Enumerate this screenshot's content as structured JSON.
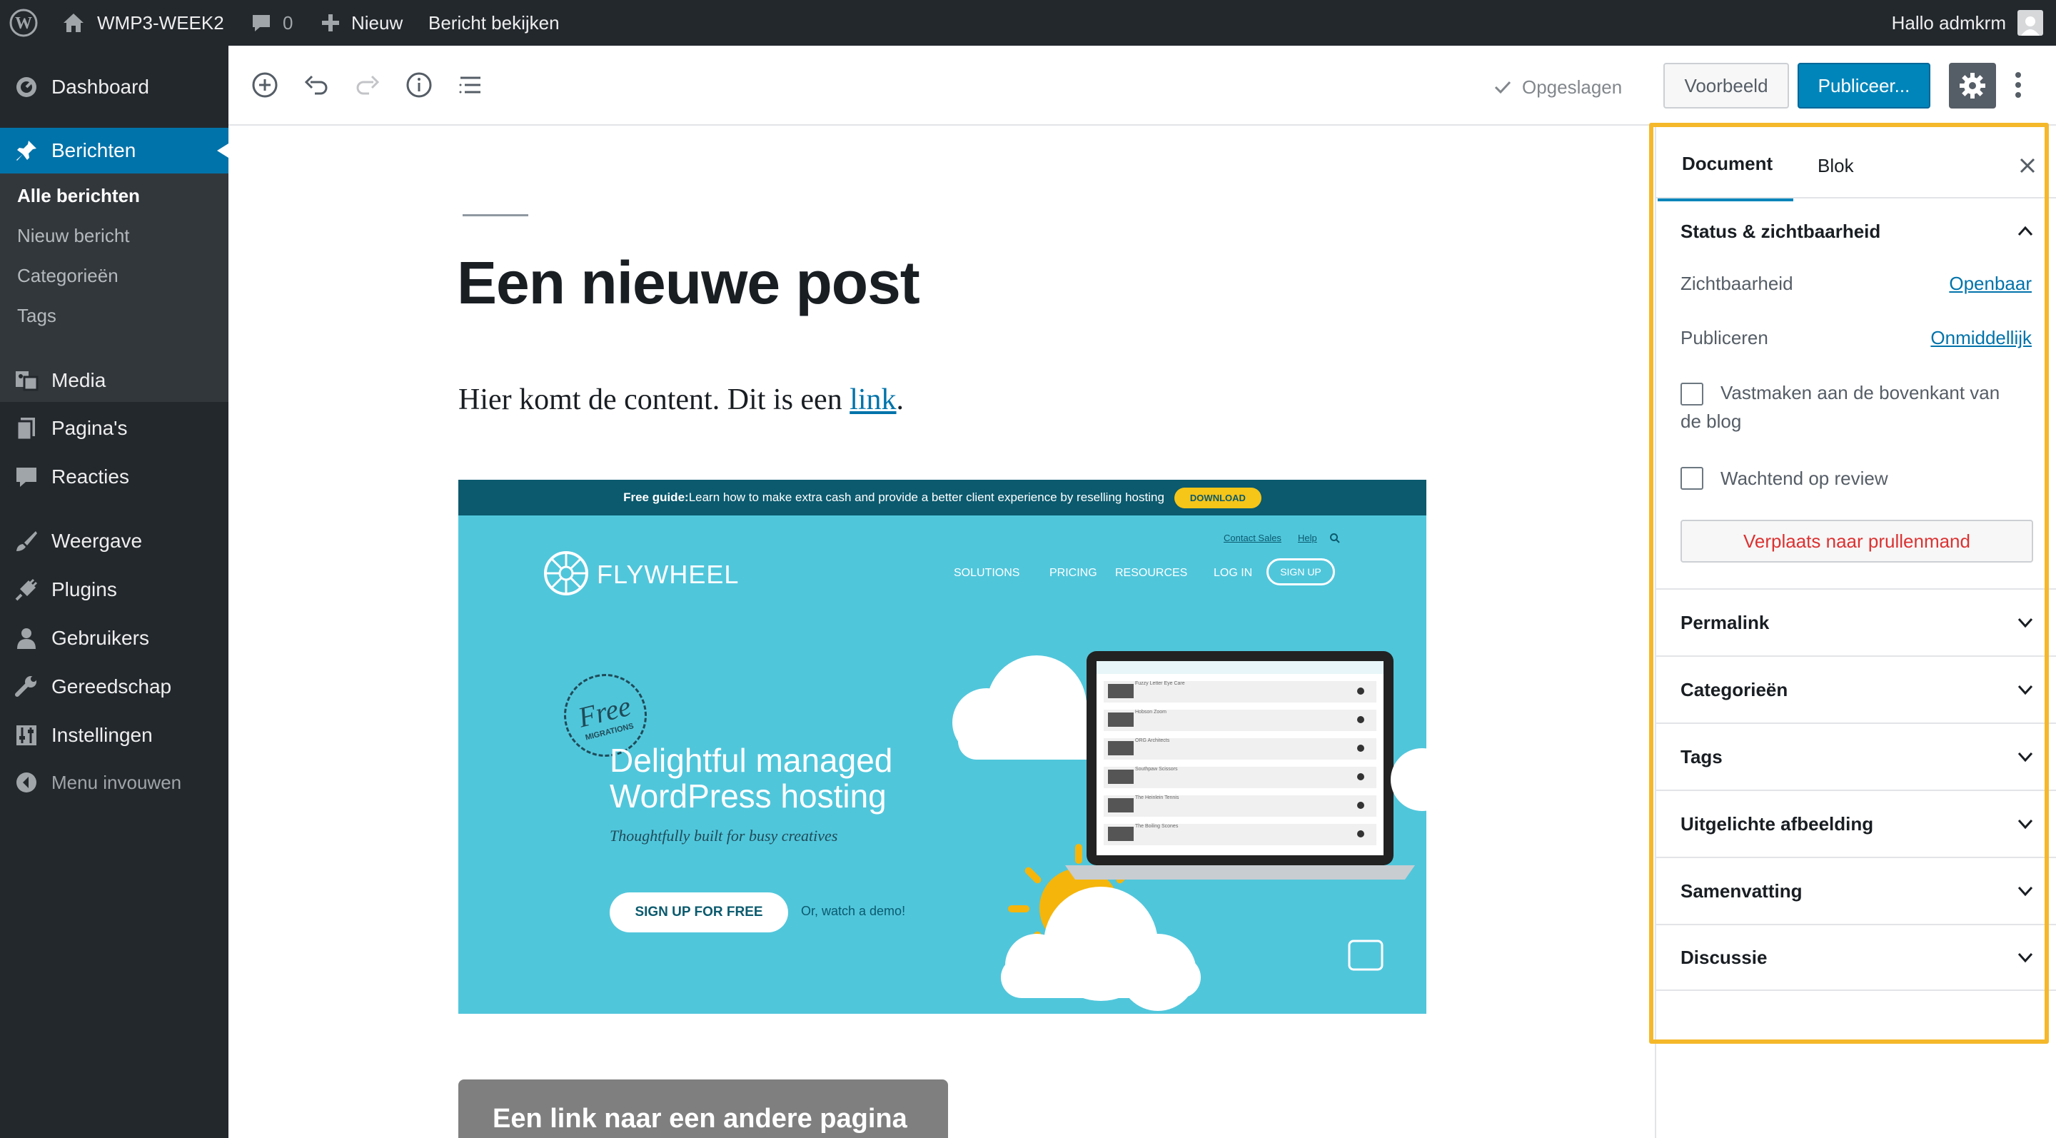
{
  "admin_bar": {
    "site_name": "WMP3-WEEK2",
    "comment_count": "0",
    "new_label": "Nieuw",
    "view_post_label": "Bericht bekijken",
    "greeting": "Hallo admkrm"
  },
  "menu": {
    "dashboard": "Dashboard",
    "berichten": "Berichten",
    "submenu": {
      "all_posts": "Alle berichten",
      "new_post": "Nieuw bericht",
      "categories": "Categorieën",
      "tags": "Tags"
    },
    "media": "Media",
    "pages": "Pagina's",
    "comments": "Reacties",
    "appearance": "Weergave",
    "plugins": "Plugins",
    "users": "Gebruikers",
    "tools": "Gereedschap",
    "settings": "Instellingen",
    "collapse": "Menu invouwen"
  },
  "toolbar": {
    "saved_label": "Opgeslagen",
    "preview_label": "Voorbeeld",
    "publish_label": "Publiceer..."
  },
  "post": {
    "title": "Een nieuwe post",
    "paragraph_before": "Hier komt de content. Dit is een ",
    "link_text": "link",
    "paragraph_after": ".",
    "button_text": "Een link naar een andere pagina"
  },
  "image": {
    "banner_prefix": "Free guide:",
    "banner_text": " Learn how to make extra cash and provide a better client experience by reselling hosting",
    "banner_button": "DOWNLOAD",
    "contact_sales": "Contact Sales",
    "help": "Help",
    "brand": "FLYWHEEL",
    "nav": [
      "SOLUTIONS",
      "PRICING",
      "RESOURCES",
      "LOG IN"
    ],
    "signup": "SIGN UP",
    "badge_line1": "Free",
    "badge_line2": "MIGRATIONS",
    "headline_line1": "Delightful managed",
    "headline_line2": "WordPress hosting",
    "tagline": "Thoughtfully built for busy creatives",
    "cta": "SIGN UP FOR FREE",
    "demo": "Or, watch a demo!",
    "laptop_rows": [
      "Fuzzy Letter Eye Care",
      "Hobson Zoom",
      "ORG Architects",
      "Southpaw Scissors",
      "The Heinlein Tennis",
      "The Boiling Scones"
    ]
  },
  "sidebar": {
    "tab_document": "Document",
    "tab_block": "Blok",
    "status_title": "Status & zichtbaarheid",
    "visibility_label": "Zichtbaarheid",
    "visibility_value": "Openbaar",
    "publish_label": "Publiceren",
    "publish_value": "Onmiddellijk",
    "sticky_label": "Vastmaken aan de bovenkant van de blog",
    "pending_label": "Wachtend op review",
    "trash_label": "Verplaats naar prullenmand",
    "panels": [
      "Permalink",
      "Categorieën",
      "Tags",
      "Uitgelichte afbeelding",
      "Samenvatting",
      "Discussie"
    ]
  },
  "colors": {
    "admin_dark": "#23282d",
    "admin_blue": "#0073aa",
    "highlight": "#f5b82b",
    "flywheel_teal": "#50c6db",
    "danger": "#dc3232"
  }
}
